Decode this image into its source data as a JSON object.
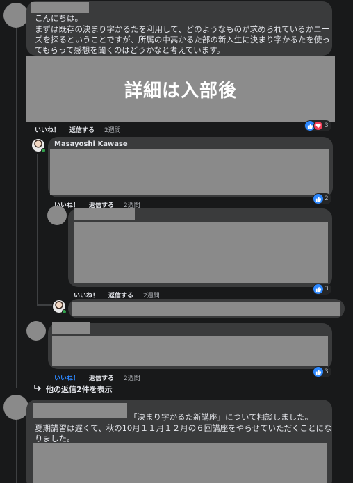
{
  "comment1": {
    "text_lines": [
      "こんにちは。",
      "まずは既存の決まり字かるたを利用して、どのようなものが求められているかニー",
      "ズを探るということですが、所属の中高かるた部の新入生に決まり字かるたを使っ",
      "てもらって感想を聞くのはどうかなと考えています。"
    ],
    "banner_text": "詳細は入部後",
    "actions": {
      "like": "いいね！",
      "reply": "返信する",
      "time": "2週間"
    },
    "reaction_count": "3"
  },
  "reply1": {
    "author": "Masayoshi Kawase",
    "actions": {
      "like": "いいね！",
      "reply": "返信する",
      "time": "2週間"
    },
    "reaction_count": "2"
  },
  "reply2": {
    "actions": {
      "like": "いいね！",
      "reply": "返信する",
      "time": "2週間"
    },
    "reaction_count": "3"
  },
  "reply3": {
    "actions": {
      "like": "いいね！",
      "reply": "返信する",
      "time": "2週間"
    },
    "reaction_count": "3"
  },
  "more_replies_label": "他の返信2件を表示",
  "comment2": {
    "line1_suffix": "「決まり字かるた新講座」について相談しました。",
    "text_lines": [
      "夏期講習は遅くて、秋の10月１１月１２月の６回講座をやらせていただくことにな",
      "りました。"
    ]
  },
  "colors": {
    "accent": "#2d88ff",
    "love": "#f33e58",
    "bubble": "#3a3b3c",
    "background": "#18191a"
  }
}
